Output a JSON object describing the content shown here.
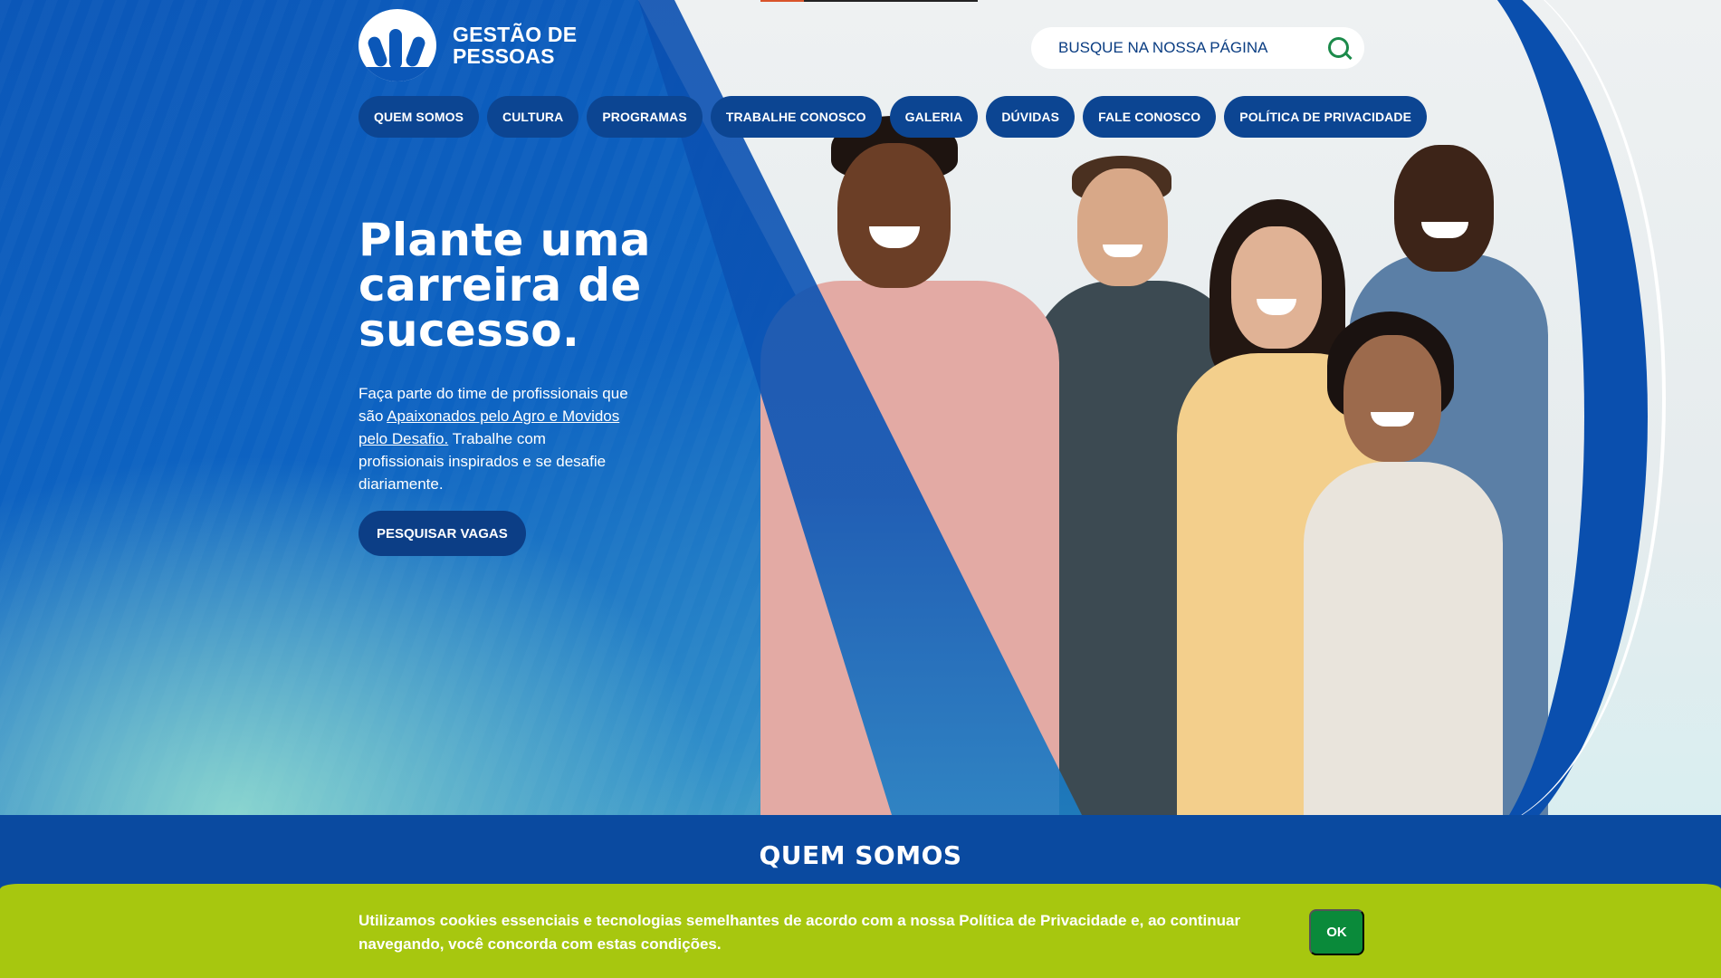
{
  "logo": {
    "line1": "GESTÃO DE",
    "line2": "PESSOAS"
  },
  "search": {
    "placeholder": "BUSQUE NA NOSSA PÁGINA"
  },
  "nav": {
    "items": [
      {
        "label": "QUEM SOMOS"
      },
      {
        "label": "CULTURA"
      },
      {
        "label": "PROGRAMAS"
      },
      {
        "label": "TRABALHE CONOSCO"
      },
      {
        "label": "GALERIA"
      },
      {
        "label": "DÚVIDAS"
      },
      {
        "label": "FALE CONOSCO"
      },
      {
        "label": "POLÍTICA DE PRIVACIDADE"
      }
    ]
  },
  "hero": {
    "headline_line1": "Plante uma",
    "headline_line2": "carreira de",
    "headline_line3": "sucesso.",
    "intro_before": "Faça parte do time de profissionais que são ",
    "intro_link": "Apaixonados pelo Agro e Movidos pelo Desafio.",
    "intro_after": " Trabalhe com profissionais inspirados e se desafie diariamente.",
    "cta_label": "PESQUISAR VAGAS"
  },
  "section": {
    "title": "QUEM SOMOS"
  },
  "cookie": {
    "text": "Utilizamos cookies essenciais e tecnologias semelhantes de acordo com a nossa Política de Privacidade e, ao continuar navegando, você concorda com estas condições.",
    "ok_label": "OK"
  },
  "colors": {
    "primary_blue": "#0b57b8",
    "nav_pill": "#0c4592",
    "cookie_bar": "#a7c70f",
    "ok_button": "#0a8a3a",
    "search_icon": "#1b8a4a"
  },
  "icons": [
    "logo-mark",
    "search-icon"
  ]
}
